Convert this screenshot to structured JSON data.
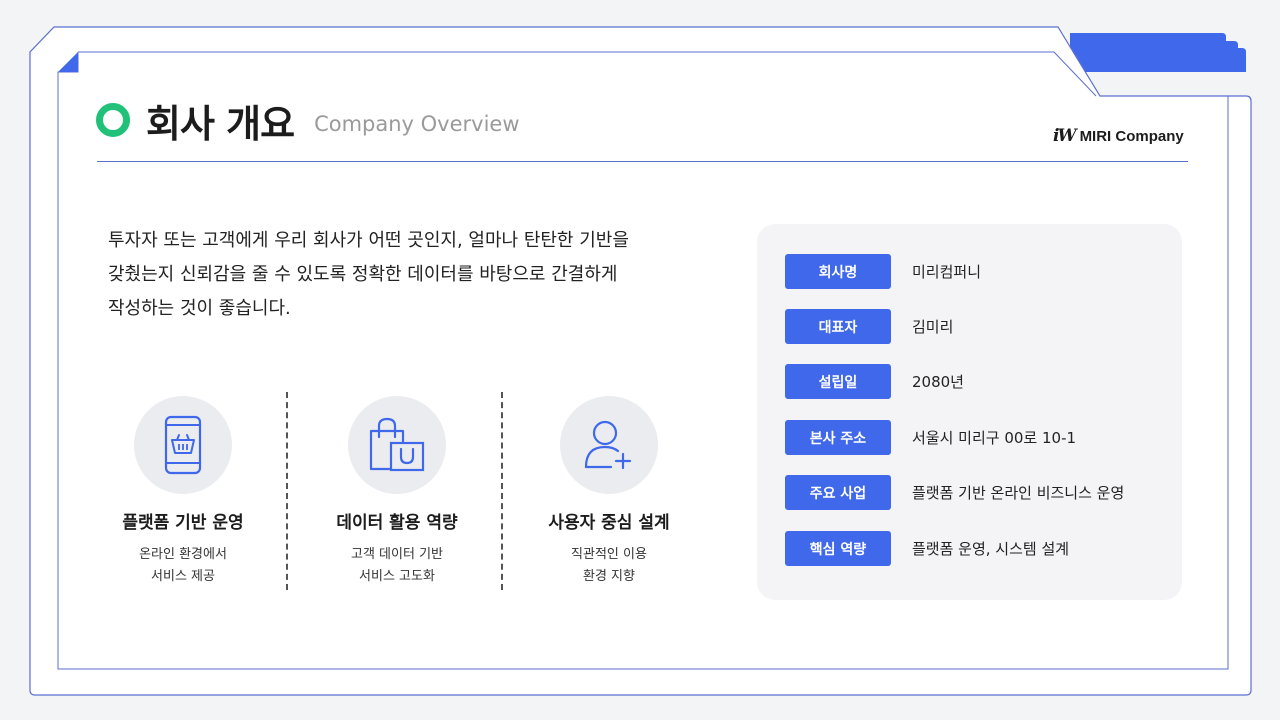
{
  "header": {
    "title_ko": "회사 개요",
    "title_en": "Company Overview",
    "brand_logo": "iW",
    "brand_name": "MIRI Company"
  },
  "intro": {
    "lines": [
      "투자자 또는 고객에게 우리 회사가 어떤 곳인지, 얼마나 탄탄한 기반을",
      "갖췄는지 신뢰감을 줄 수 있도록 정확한 데이터를 바탕으로 간결하게",
      "작성하는 것이 좋습니다."
    ]
  },
  "features": [
    {
      "icon": "mobile-shopping-basket-icon",
      "title": "플랫폼 기반 운영",
      "desc": [
        "온라인 환경에서",
        "서비스 제공"
      ]
    },
    {
      "icon": "shopping-bag-icon",
      "title": "데이터 활용 역량",
      "desc": [
        "고객 데이터 기반",
        "서비스 고도화"
      ]
    },
    {
      "icon": "add-user-icon",
      "title": "사용자 중심 설계",
      "desc": [
        "직관적인 이용",
        "환경 지향"
      ]
    }
  ],
  "company_info": [
    {
      "label": "회사명",
      "value": "미리컴퍼니"
    },
    {
      "label": "대표자",
      "value": "김미리"
    },
    {
      "label": "설립일",
      "value": "2080년"
    },
    {
      "label": "본사 주소",
      "value": "서울시 미리구 00로 10-1"
    },
    {
      "label": "주요 사업",
      "value": "플랫폼 기반 온라인 비즈니스 운영"
    },
    {
      "label": "핵심 역량",
      "value": "플랫폼 운영, 시스템 설계"
    }
  ],
  "colors": {
    "accent": "#3f68ea",
    "frame": "#5b6fcf",
    "title_dot": "#22c17a",
    "panel_bg": "#f4f4f6"
  }
}
